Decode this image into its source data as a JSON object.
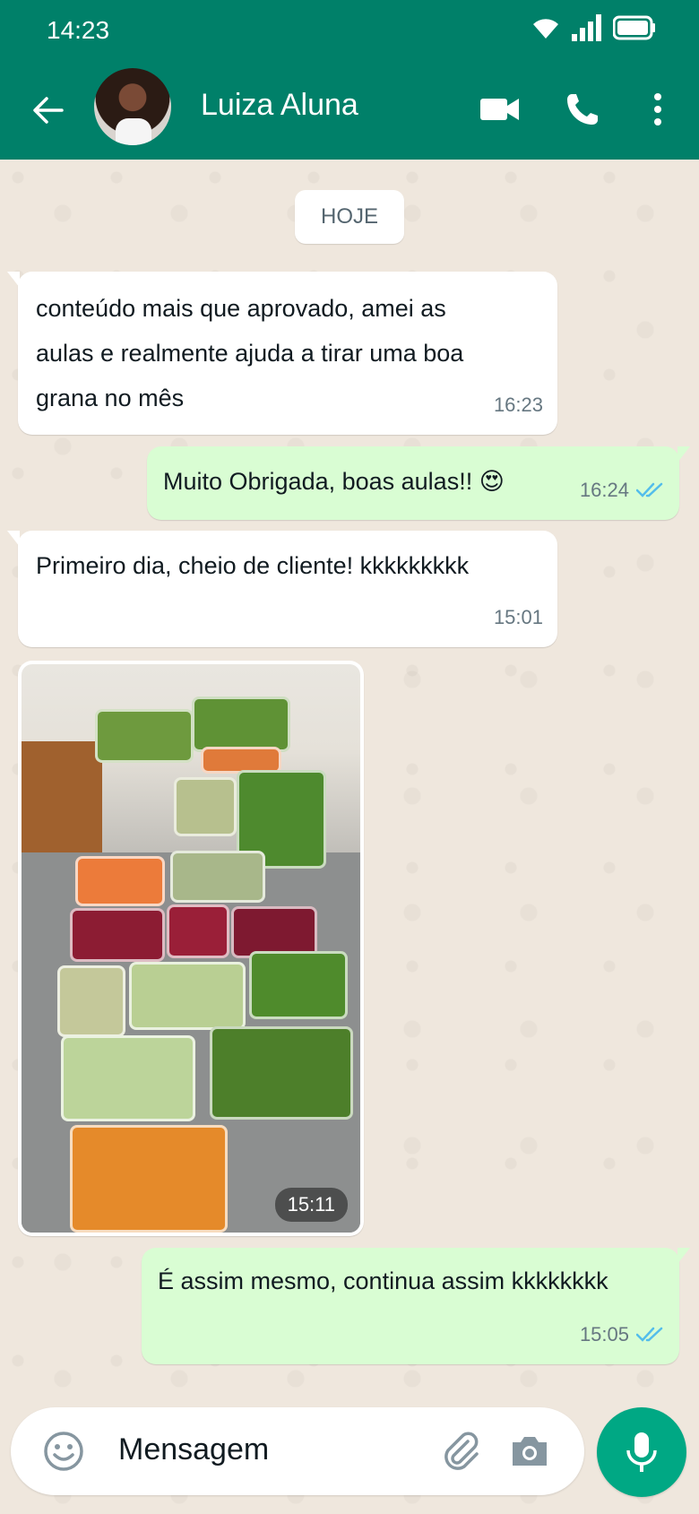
{
  "status_bar": {
    "time": "14:23",
    "icons": [
      "wifi-icon",
      "signal-icon",
      "battery-icon"
    ]
  },
  "header": {
    "contact_name": "Luiza Aluna",
    "icons": [
      "back-arrow-icon",
      "video-call-icon",
      "voice-call-icon",
      "more-vert-icon"
    ]
  },
  "chat": {
    "date_chip": "HOJE",
    "messages": [
      {
        "direction": "in",
        "text_lines": [
          "conteúdo mais que aprovado, amei as",
          "aulas e realmente ajuda a tirar uma boa",
          "grana no mês"
        ],
        "time": "16:23"
      },
      {
        "direction": "out",
        "text": "Muito Obrigada, boas aulas!! 😍",
        "time": "16:24",
        "status": "read"
      },
      {
        "direction": "in",
        "text": "Primeiro dia, cheio de cliente! kkkkkkkkk",
        "time": "15:01"
      },
      {
        "direction": "in",
        "type": "image",
        "time": "15:11"
      },
      {
        "direction": "out",
        "text": "É assim mesmo, continua assim kkkkkkkk",
        "time": "15:05",
        "status": "read"
      }
    ]
  },
  "composer": {
    "placeholder": "Mensagem",
    "icons": [
      "emoji-icon",
      "attach-icon",
      "camera-icon",
      "mic-icon"
    ]
  },
  "colors": {
    "header": "#008069",
    "outgoing_bubble": "#d9fdd3",
    "incoming_bubble": "#ffffff",
    "mic_button": "#00a884",
    "read_ticks": "#53bdeb",
    "wallpaper": "#efe7dd"
  }
}
